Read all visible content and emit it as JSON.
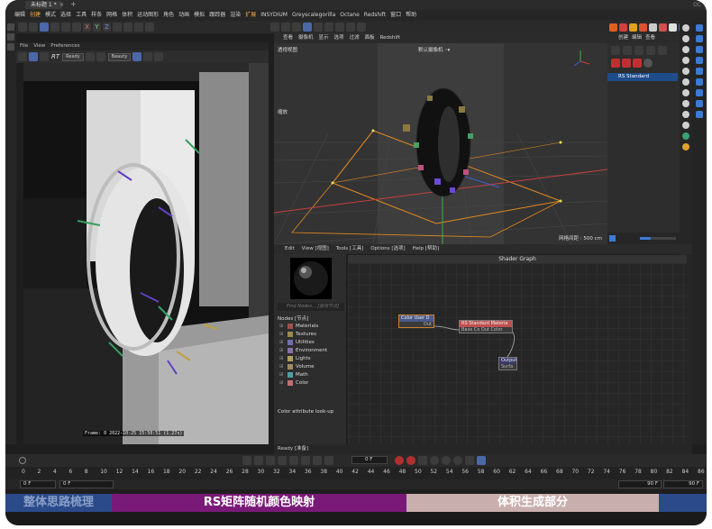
{
  "window": {
    "tab_title": "未标题 1 *",
    "tab_close": "×",
    "tab_add": "+",
    "right_label": "OC"
  },
  "menubar": [
    "编辑",
    "创建",
    "模式",
    "选择",
    "工具",
    "样条",
    "网格",
    "体积",
    "运动图形",
    "角色",
    "动画",
    "模拟",
    "跟踪器",
    "渲染",
    "扩展",
    "INSYDIUM",
    "Greyscalegorilla",
    "Octane",
    "Redshift",
    "窗口",
    "帮助"
  ],
  "menubar_active": [
    1,
    14
  ],
  "main_toolbar": {
    "axis_x": "X",
    "axis_y": "Y",
    "axis_z": "Z"
  },
  "picture_viewer": {
    "menu": [
      "File",
      "View",
      "Preferences"
    ],
    "rt_label": "RT",
    "ready_select": "Ready",
    "beauty_select": "Beauty",
    "frame_info": "Frame: 0   2022-10-25  15:50:51  (1.27s)"
  },
  "viewport": {
    "menu": [
      "查看",
      "摄像机",
      "显示",
      "选项",
      "过滤",
      "面板",
      "Redshift"
    ],
    "label": "透视视图",
    "camera": "默认摄像机 ◦▾",
    "zoom_label": "缩放",
    "grid_label": "网格间距 : 500 cm"
  },
  "object_manager": {
    "menu": [
      "创建",
      "编辑",
      "查看"
    ],
    "item": "RS Standard"
  },
  "node_editor": {
    "menu": [
      "Edit",
      "View [视图]",
      "Tools [工具]",
      "Options [选项]",
      "Help [帮助]"
    ],
    "find_placeholder": "Find Nodes... [查找节点]",
    "nodes_title": "Nodes [节点]",
    "categories": [
      {
        "label": "Materials",
        "color": "#a05050"
      },
      {
        "label": "Textures",
        "color": "#9a8a50"
      },
      {
        "label": "Utilities",
        "color": "#7070b0"
      },
      {
        "label": "Environment",
        "color": "#8a70a8"
      },
      {
        "label": "Lights",
        "color": "#b0a060"
      },
      {
        "label": "Volume",
        "color": "#a08a60"
      },
      {
        "label": "Math",
        "color": "#50a0a0"
      },
      {
        "label": "Color",
        "color": "#c07070"
      }
    ],
    "color_attr": "Color attribute look-up",
    "graph_title": "Shader Graph",
    "node1_title": "Color User D",
    "node1_port": "Out",
    "node2_title": "RS Standard Materia",
    "node2_port": "Base Co Out Color",
    "node3_title": "Output",
    "node3_port": "Surfa",
    "status": "Ready [准备]"
  },
  "timeline": {
    "ticks": [
      "0",
      "2",
      "4",
      "6",
      "8",
      "10",
      "12",
      "14",
      "16",
      "18",
      "20",
      "22",
      "24",
      "26",
      "28",
      "30",
      "32",
      "34",
      "36",
      "38",
      "40",
      "42",
      "44",
      "46",
      "48",
      "50",
      "52",
      "54",
      "56",
      "58",
      "60",
      "62",
      "64",
      "66",
      "68",
      "70",
      "72",
      "74",
      "76",
      "78",
      "80",
      "82",
      "84",
      "86"
    ],
    "current_frame": "0 F",
    "start_field": "0 F",
    "start_field2": "0 F",
    "end_field": "90 F",
    "end_field2": "90 F"
  },
  "subtitles": [
    {
      "text": "整体思路梳理",
      "bg": "#2b4a8a",
      "fg": "#8aa0c8"
    },
    {
      "text": "RS矩阵随机颜色映射",
      "bg": "#7a1a78",
      "fg": "#ffffff"
    },
    {
      "text": "体积生成部分",
      "bg": "#c9aeae",
      "fg": "#ffffff"
    }
  ]
}
